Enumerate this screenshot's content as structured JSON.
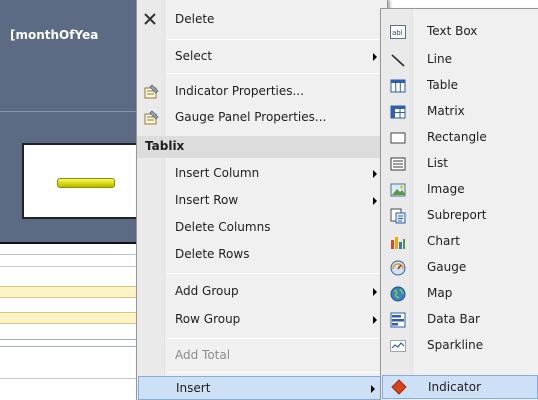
{
  "designer": {
    "header_cell_text": "[monthOfYea"
  },
  "context_menu": {
    "items": [
      {
        "label": "Delete",
        "icon": "delete-x-icon"
      },
      {
        "label": "Select",
        "submenu": true
      },
      {
        "label": "Indicator Properties...",
        "icon": "properties-icon"
      },
      {
        "label": "Gauge Panel Properties...",
        "icon": "properties-icon"
      },
      {
        "label": "Insert Column",
        "submenu": true
      },
      {
        "label": "Insert Row",
        "submenu": true
      },
      {
        "label": "Delete Columns"
      },
      {
        "label": "Delete Rows"
      },
      {
        "label": "Add Group",
        "submenu": true
      },
      {
        "label": "Row Group",
        "submenu": true
      },
      {
        "label": "Add Total",
        "disabled": true
      },
      {
        "label": "Insert",
        "submenu": true,
        "highlighted": true
      }
    ],
    "section_title": "Tablix"
  },
  "insert_submenu": {
    "items": [
      {
        "label": "Text Box",
        "icon": "textbox-icon"
      },
      {
        "label": "Line",
        "icon": "line-icon"
      },
      {
        "label": "Table",
        "icon": "table-icon"
      },
      {
        "label": "Matrix",
        "icon": "matrix-icon"
      },
      {
        "label": "Rectangle",
        "icon": "rectangle-icon"
      },
      {
        "label": "List",
        "icon": "list-icon"
      },
      {
        "label": "Image",
        "icon": "image-icon"
      },
      {
        "label": "Subreport",
        "icon": "subreport-icon"
      },
      {
        "label": "Chart",
        "icon": "chart-icon"
      },
      {
        "label": "Gauge",
        "icon": "gauge-icon"
      },
      {
        "label": "Map",
        "icon": "map-icon"
      },
      {
        "label": "Data Bar",
        "icon": "databar-icon"
      },
      {
        "label": "Sparkline",
        "icon": "sparkline-icon"
      },
      {
        "label": "Indicator",
        "icon": "indicator-icon",
        "highlighted": true
      }
    ]
  },
  "colors": {
    "menu_bg": "#f0f0f0",
    "highlight_bg": "#cde0f6",
    "highlight_border": "#84acdd",
    "designer_header": "#5c6a83"
  }
}
